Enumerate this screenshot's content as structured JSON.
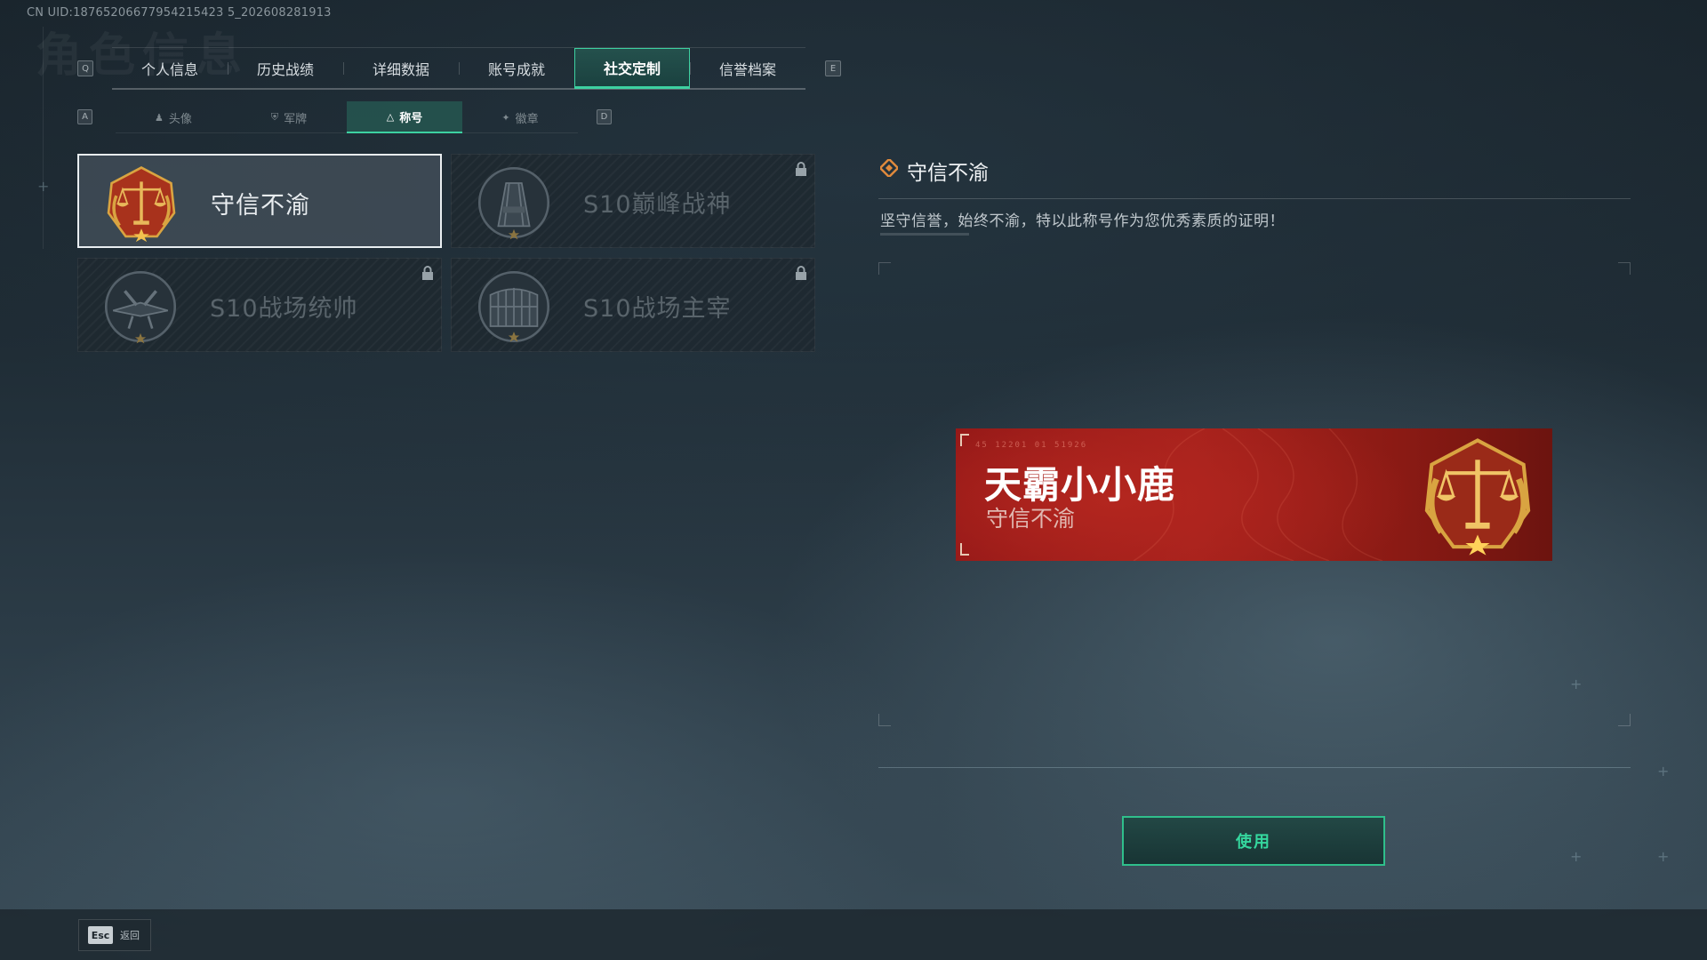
{
  "uid": "CN UID:18765206677954215423 5_202608281913",
  "ghost_title": "角色信息",
  "main_tabs": {
    "left_key": "Q",
    "right_key": "E",
    "items": [
      {
        "label": "个人信息"
      },
      {
        "label": "历史战绩"
      },
      {
        "label": "详细数据"
      },
      {
        "label": "账号成就"
      },
      {
        "label": "社交定制",
        "active": true
      },
      {
        "label": "信誉档案"
      }
    ]
  },
  "sub_tabs": {
    "left_key": "A",
    "right_key": "D",
    "items": [
      {
        "label": "头像",
        "icon": "person-icon"
      },
      {
        "label": "军牌",
        "icon": "dogtag-icon"
      },
      {
        "label": "称号",
        "icon": "title-icon",
        "active": true
      },
      {
        "label": "徽章",
        "icon": "badge-icon"
      }
    ]
  },
  "titles": [
    {
      "label": "守信不渝",
      "emblem": "scales-icon",
      "selected": true,
      "locked": false
    },
    {
      "label": "S10巅峰战神",
      "emblem": "tower-icon",
      "selected": false,
      "locked": true
    },
    {
      "label": "S10战场统帅",
      "emblem": "aircraft-icon",
      "selected": false,
      "locked": true
    },
    {
      "label": "S10战场主宰",
      "emblem": "colosseum-icon",
      "selected": false,
      "locked": true
    }
  ],
  "detail": {
    "title": "守信不渝",
    "description": "坚守信誉，始终不渝，特以此称号作为您优秀素质的证明！"
  },
  "banner": {
    "player_name": "天霸小小鹿",
    "title": "守信不渝",
    "code": "45 12201 01 51926"
  },
  "use_button": "使用",
  "footer": {
    "esc_key": "Esc",
    "back_label": "返回"
  },
  "colors": {
    "accent": "#3dd1a1",
    "banner_red": "#a4211c",
    "emblem_red": "#a8321c",
    "gold": "#d9a441"
  }
}
